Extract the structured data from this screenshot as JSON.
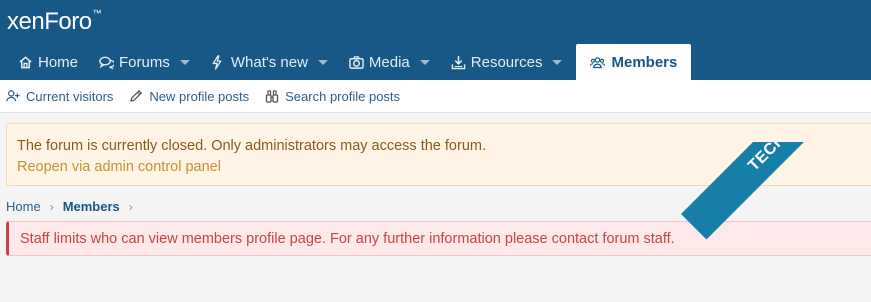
{
  "header": {
    "logo": "xenForo",
    "logo_tm": "™",
    "brand_color": "#185886"
  },
  "nav": {
    "tabs": [
      {
        "label": "Home",
        "icon": "home-icon",
        "dropdown": false
      },
      {
        "label": "Forums",
        "icon": "chat-bubbles-icon",
        "dropdown": true
      },
      {
        "label": "What's new",
        "icon": "bolt-icon",
        "dropdown": true
      },
      {
        "label": "Media",
        "icon": "camera-icon",
        "dropdown": true
      },
      {
        "label": "Resources",
        "icon": "download-icon",
        "dropdown": true
      },
      {
        "label": "Members",
        "icon": "users-icon",
        "dropdown": false,
        "active": true
      }
    ]
  },
  "subnav": {
    "items": [
      {
        "label": "Current visitors",
        "icon": "user-plus-icon"
      },
      {
        "label": "New profile posts",
        "icon": "pencil-icon"
      },
      {
        "label": "Search profile posts",
        "icon": "binoculars-icon"
      }
    ]
  },
  "notice": {
    "text": "The forum is currently closed. Only administrators may access the forum.",
    "link": "Reopen via admin control panel"
  },
  "breadcrumb": {
    "home": "Home",
    "members": "Members",
    "separator": "›"
  },
  "error": {
    "text": "Staff limits who can view members profile page. For any further information please contact forum staff."
  },
  "watermark": {
    "text": "TECHIESHOME.COM"
  }
}
